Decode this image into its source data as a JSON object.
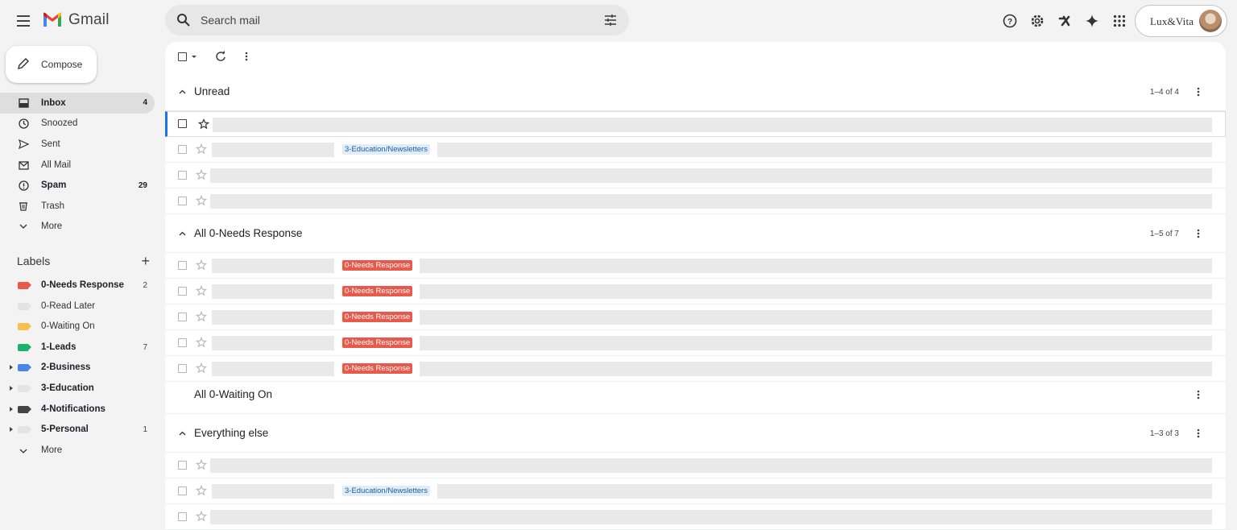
{
  "app": {
    "name": "Gmail"
  },
  "search": {
    "placeholder": "Search mail"
  },
  "account": {
    "name": "Lux&Vita"
  },
  "compose": {
    "label": "Compose"
  },
  "nav": [
    {
      "label": "Inbox",
      "count": "4",
      "icon": "inbox-icon",
      "bold": true,
      "active": true
    },
    {
      "label": "Snoozed",
      "count": "",
      "icon": "clock-icon"
    },
    {
      "label": "Sent",
      "count": "",
      "icon": "send-icon"
    },
    {
      "label": "All Mail",
      "count": "",
      "icon": "all-mail-icon"
    },
    {
      "label": "Spam",
      "count": "29",
      "icon": "spam-icon",
      "bold": true
    },
    {
      "label": "Trash",
      "count": "",
      "icon": "trash-icon"
    },
    {
      "label": "More",
      "count": "",
      "icon": "chevron-down-icon"
    }
  ],
  "labels_title": "Labels",
  "labels": [
    {
      "label": "0-Needs Response",
      "count": "2",
      "color": "#e8594c",
      "bold": true,
      "expandable": false
    },
    {
      "label": "0-Read Later",
      "count": "",
      "color": "#e3e3e3",
      "bold": false,
      "expandable": false
    },
    {
      "label": "0-Waiting On",
      "count": "",
      "color": "#f6c04f",
      "bold": false,
      "expandable": false
    },
    {
      "label": "1-Leads",
      "count": "7",
      "color": "#1bb36b",
      "bold": true,
      "expandable": false
    },
    {
      "label": "2-Business",
      "count": "",
      "color": "#4a86e8",
      "bold": true,
      "expandable": true
    },
    {
      "label": "3-Education",
      "count": "",
      "color": "#e3e3e3",
      "bold": true,
      "expandable": true
    },
    {
      "label": "4-Notifications",
      "count": "",
      "color": "#444444",
      "bold": true,
      "expandable": true
    },
    {
      "label": "5-Personal",
      "count": "1",
      "color": "#e3e3e3",
      "bold": true,
      "expandable": true
    }
  ],
  "labels_more": "More",
  "sections": [
    {
      "title": "Unread",
      "range": "1–4 of 4",
      "collapsible": true,
      "rows": [
        {
          "first": true,
          "chip": ""
        },
        {
          "chip": "3-Education/Newsletters",
          "chip_type": "edu"
        },
        {
          "chip": ""
        },
        {
          "chip": ""
        }
      ]
    },
    {
      "title": "All 0-Needs Response",
      "range": "1–5 of 7",
      "collapsible": true,
      "rows": [
        {
          "chip": "0-Needs Response",
          "chip_type": "nr"
        },
        {
          "chip": "0-Needs Response",
          "chip_type": "nr"
        },
        {
          "chip": "0-Needs Response",
          "chip_type": "nr"
        },
        {
          "chip": "0-Needs Response",
          "chip_type": "nr"
        },
        {
          "chip": "0-Needs Response",
          "chip_type": "nr"
        }
      ]
    },
    {
      "title": "All 0-Waiting On",
      "range": "",
      "collapsible": false,
      "rows": []
    },
    {
      "title": "Everything else",
      "range": "1–3 of 3",
      "collapsible": true,
      "rows": [
        {
          "chip": ""
        },
        {
          "chip": "3-Education/Newsletters",
          "chip_type": "edu"
        },
        {
          "chip": ""
        }
      ]
    }
  ]
}
